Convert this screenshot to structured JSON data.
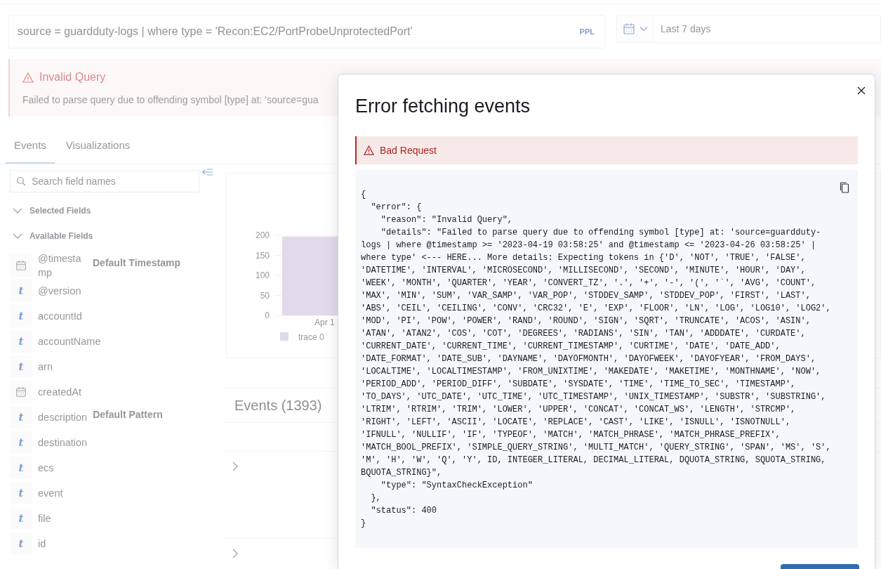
{
  "query_bar": {
    "value": "source = guardduty-logs | where type = 'Recon:EC2/PortProbeUnprotectedPort'",
    "language": "PPL"
  },
  "date_picker": {
    "value": "Last 7 days"
  },
  "alert": {
    "title": "Invalid Query",
    "message": "Failed to parse query due to offending symbol [type] at: 'source=gua"
  },
  "tabs": [
    {
      "label": "Events",
      "selected": true
    },
    {
      "label": "Visualizations",
      "selected": false
    }
  ],
  "sidebar": {
    "search": {
      "placeholder": "Search field names"
    },
    "sections": [
      {
        "label": "Selected Fields",
        "expanded": true
      },
      {
        "label": "Available Fields",
        "expanded": true
      }
    ],
    "fields": [
      {
        "name": "@timestamp",
        "kind": "date",
        "badge": "Default Timestamp"
      },
      {
        "name": "@version",
        "kind": "string",
        "icon": "t"
      },
      {
        "name": "accountId",
        "kind": "string",
        "icon": "t"
      },
      {
        "name": "accountName",
        "kind": "string",
        "icon": "t"
      },
      {
        "name": "arn",
        "kind": "string",
        "icon": "t"
      },
      {
        "name": "createdAt",
        "kind": "date"
      },
      {
        "name": "description",
        "kind": "string",
        "icon": "t",
        "badge": "Default Pattern"
      },
      {
        "name": "destination",
        "kind": "string",
        "icon": "t"
      },
      {
        "name": "ecs",
        "kind": "string",
        "icon": "t"
      },
      {
        "name": "event",
        "kind": "string",
        "icon": "t"
      },
      {
        "name": "file",
        "kind": "string",
        "icon": "t"
      },
      {
        "name": "id",
        "kind": "string",
        "icon": "t"
      }
    ]
  },
  "chart": {
    "chart_data": {
      "type": "bar",
      "categories": [
        "Apr 1"
      ],
      "series": [
        {
          "name": "trace 0",
          "color": "#e2d9ea",
          "values": [
            197
          ]
        }
      ],
      "grid": true,
      "ylim": [
        0,
        200
      ],
      "yticks": [
        0,
        50,
        100,
        150,
        200
      ]
    }
  },
  "events": {
    "title": "Events (1393)",
    "rows": [
      {
        "expanded": false
      },
      {
        "expanded": false
      }
    ]
  },
  "modal": {
    "title": "Error fetching events",
    "callout": "Bad Request",
    "code_lines": [
      "{",
      "  \"error\": {",
      "    \"reason\": \"Invalid Query\",",
      "    \"details\": \"Failed to parse query due to offending symbol [type] at: 'source=guardduty-",
      "logs | where @timestamp >= '2023-04-19 03:58:25' and @timestamp <= '2023-04-26 03:58:25' |",
      "where type' <--- HERE... More details: Expecting tokens in {'D', 'NOT', 'TRUE', 'FALSE',",
      "'DATETIME', 'INTERVAL', 'MICROSECOND', 'MILLISECOND', 'SECOND', 'MINUTE', 'HOUR', 'DAY',",
      "'WEEK', 'MONTH', 'QUARTER', 'YEAR', 'CONVERT_TZ', '.', '+', '-', '(', '`', 'AVG', 'COUNT',",
      "'MAX', 'MIN', 'SUM', 'VAR_SAMP', 'VAR_POP', 'STDDEV_SAMP', 'STDDEV_POP', 'FIRST', 'LAST',",
      "'ABS', 'CEIL', 'CEILING', 'CONV', 'CRC32', 'E', 'EXP', 'FLOOR', 'LN', 'LOG', 'LOG10', 'LOG2',",
      "'MOD', 'PI', 'POW', 'POWER', 'RAND', 'ROUND', 'SIGN', 'SQRT', 'TRUNCATE', 'ACOS', 'ASIN',",
      "'ATAN', 'ATAN2', 'COS', 'COT', 'DEGREES', 'RADIANS', 'SIN', 'TAN', 'ADDDATE', 'CURDATE',",
      "'CURRENT_DATE', 'CURRENT_TIME', 'CURRENT_TIMESTAMP', 'CURTIME', 'DATE', 'DATE_ADD',",
      "'DATE_FORMAT', 'DATE_SUB', 'DAYNAME', 'DAYOFMONTH', 'DAYOFWEEK', 'DAYOFYEAR', 'FROM_DAYS',",
      "'LOCALTIME', 'LOCALTIMESTAMP', 'FROM_UNIXTIME', 'MAKEDATE', 'MAKETIME', 'MONTHNAME', 'NOW',",
      "'PERIOD_ADD', 'PERIOD_DIFF', 'SUBDATE', 'SYSDATE', 'TIME', 'TIME_TO_SEC', 'TIMESTAMP',",
      "'TO_DAYS', 'UTC_DATE', 'UTC_TIME', 'UTC_TIMESTAMP', 'UNIX_TIMESTAMP', 'SUBSTR', 'SUBSTRING',",
      "'LTRIM', 'RTRIM', 'TRIM', 'LOWER', 'UPPER', 'CONCAT', 'CONCAT_WS', 'LENGTH', 'STRCMP',",
      "'RIGHT', 'LEFT', 'ASCII', 'LOCATE', 'REPLACE', 'CAST', 'LIKE', 'ISNULL', 'ISNOTNULL',",
      "'IFNULL', 'NULLIF', 'IF', 'TYPEOF', 'MATCH', 'MATCH_PHRASE', 'MATCH_PHRASE_PREFIX',",
      "'MATCH_BOOL_PREFIX', 'SIMPLE_QUERY_STRING', 'MULTI_MATCH', 'QUERY_STRING', 'SPAN', 'MS', 'S',",
      "'M', 'H', 'W', 'Q', 'Y', ID, INTEGER_LITERAL, DECIMAL_LITERAL, DQUOTA_STRING, SQUOTA_STRING,",
      "BQUOTA_STRING}\",",
      "    \"type\": \"SyntaxCheckException\"",
      "  },",
      "  \"status\": 400",
      "}"
    ]
  }
}
